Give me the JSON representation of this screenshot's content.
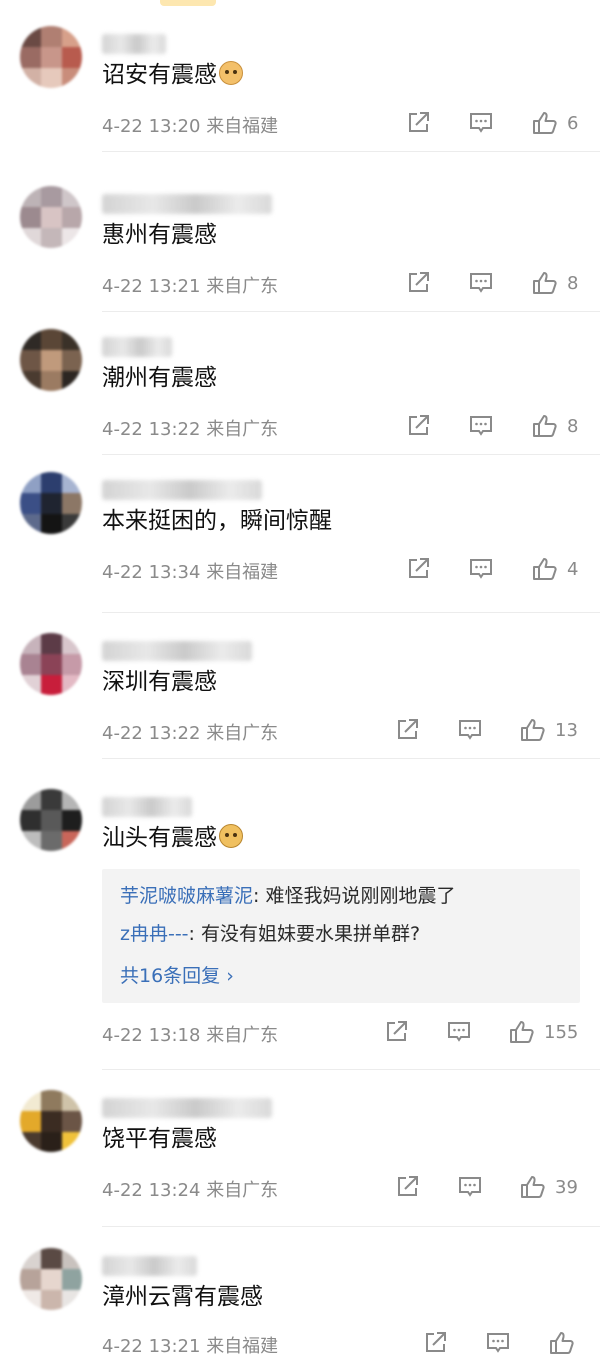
{
  "icons": {
    "share": "share-icon",
    "comment": "comment-icon",
    "like": "like-icon"
  },
  "comments": [
    {
      "text": "诏安有震感",
      "emoji": "cat",
      "time": "4-22 13:20",
      "source": "来自福建",
      "likes": "6"
    },
    {
      "text": "惠州有震感",
      "time": "4-22 13:21",
      "source": "来自广东",
      "likes": "8"
    },
    {
      "text": "潮州有震感",
      "time": "4-22 13:22",
      "source": "来自广东",
      "likes": "8"
    },
    {
      "text": "本来挺困的，瞬间惊醒",
      "time": "4-22 13:34",
      "source": "来自福建",
      "likes": "4"
    },
    {
      "text": "深圳有震感",
      "time": "4-22 13:22",
      "source": "来自广东",
      "likes": "13"
    },
    {
      "text": "汕头有震感",
      "emoji": "doge",
      "time": "4-22 13:18",
      "source": "来自广东",
      "likes": "155",
      "replies": [
        {
          "user": "芋泥啵啵麻薯泥",
          "text": ": 难怪我妈说刚刚地震了"
        },
        {
          "user": "z冉冉---",
          "text": ": 有没有姐妹要水果拼单群?"
        }
      ],
      "more_replies": "共16条回复 ›"
    },
    {
      "text": "饶平有震感",
      "time": "4-22 13:24",
      "source": "来自广东",
      "likes": "39"
    },
    {
      "text": "漳州云霄有震感",
      "time": "4-22 13:21",
      "source": "来自福建",
      "likes": ""
    }
  ]
}
